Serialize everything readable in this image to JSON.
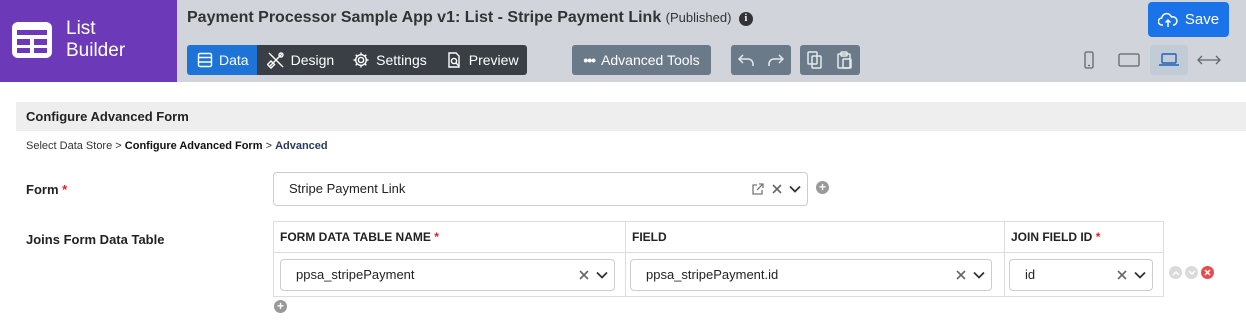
{
  "brand": {
    "line1": "List",
    "line2": "Builder"
  },
  "app": {
    "title": "Payment Processor Sample App v1: List - Stripe Payment Link",
    "status": "(Published)"
  },
  "tabs": [
    {
      "label": "Data",
      "icon": "table-icon",
      "active": true
    },
    {
      "label": "Design",
      "icon": "design-tools-icon",
      "active": false
    },
    {
      "label": "Settings",
      "icon": "gear-icon",
      "active": false
    },
    {
      "label": "Preview",
      "icon": "preview-icon",
      "active": false
    }
  ],
  "toolbar": {
    "advanced_tools_label": "Advanced Tools",
    "save_label": "Save"
  },
  "section": {
    "title": "Configure Advanced Form",
    "breadcrumb": {
      "step1": "Select Data Store",
      "separator": ">",
      "step2": "Configure Advanced Form",
      "step3": "Advanced"
    }
  },
  "form_field": {
    "label": "Form",
    "required_mark": "*",
    "value": "Stripe Payment Link"
  },
  "joins": {
    "label": "Joins Form Data Table",
    "columns": [
      {
        "header": "FORM DATA TABLE NAME",
        "required_mark": "*"
      },
      {
        "header": "FIELD",
        "required_mark": ""
      },
      {
        "header": "JOIN FIELD ID",
        "required_mark": "*"
      }
    ],
    "rows": [
      {
        "table_name": "ppsa_stripePayment",
        "field": "ppsa_stripePayment.id",
        "join_field_id": "id"
      }
    ]
  },
  "colors": {
    "brand_purple": "#6c3ab8",
    "active_tab_blue": "#1e74d6",
    "save_blue": "#1a73e8",
    "required_red": "#dd2222",
    "remove_red": "#e05050"
  }
}
